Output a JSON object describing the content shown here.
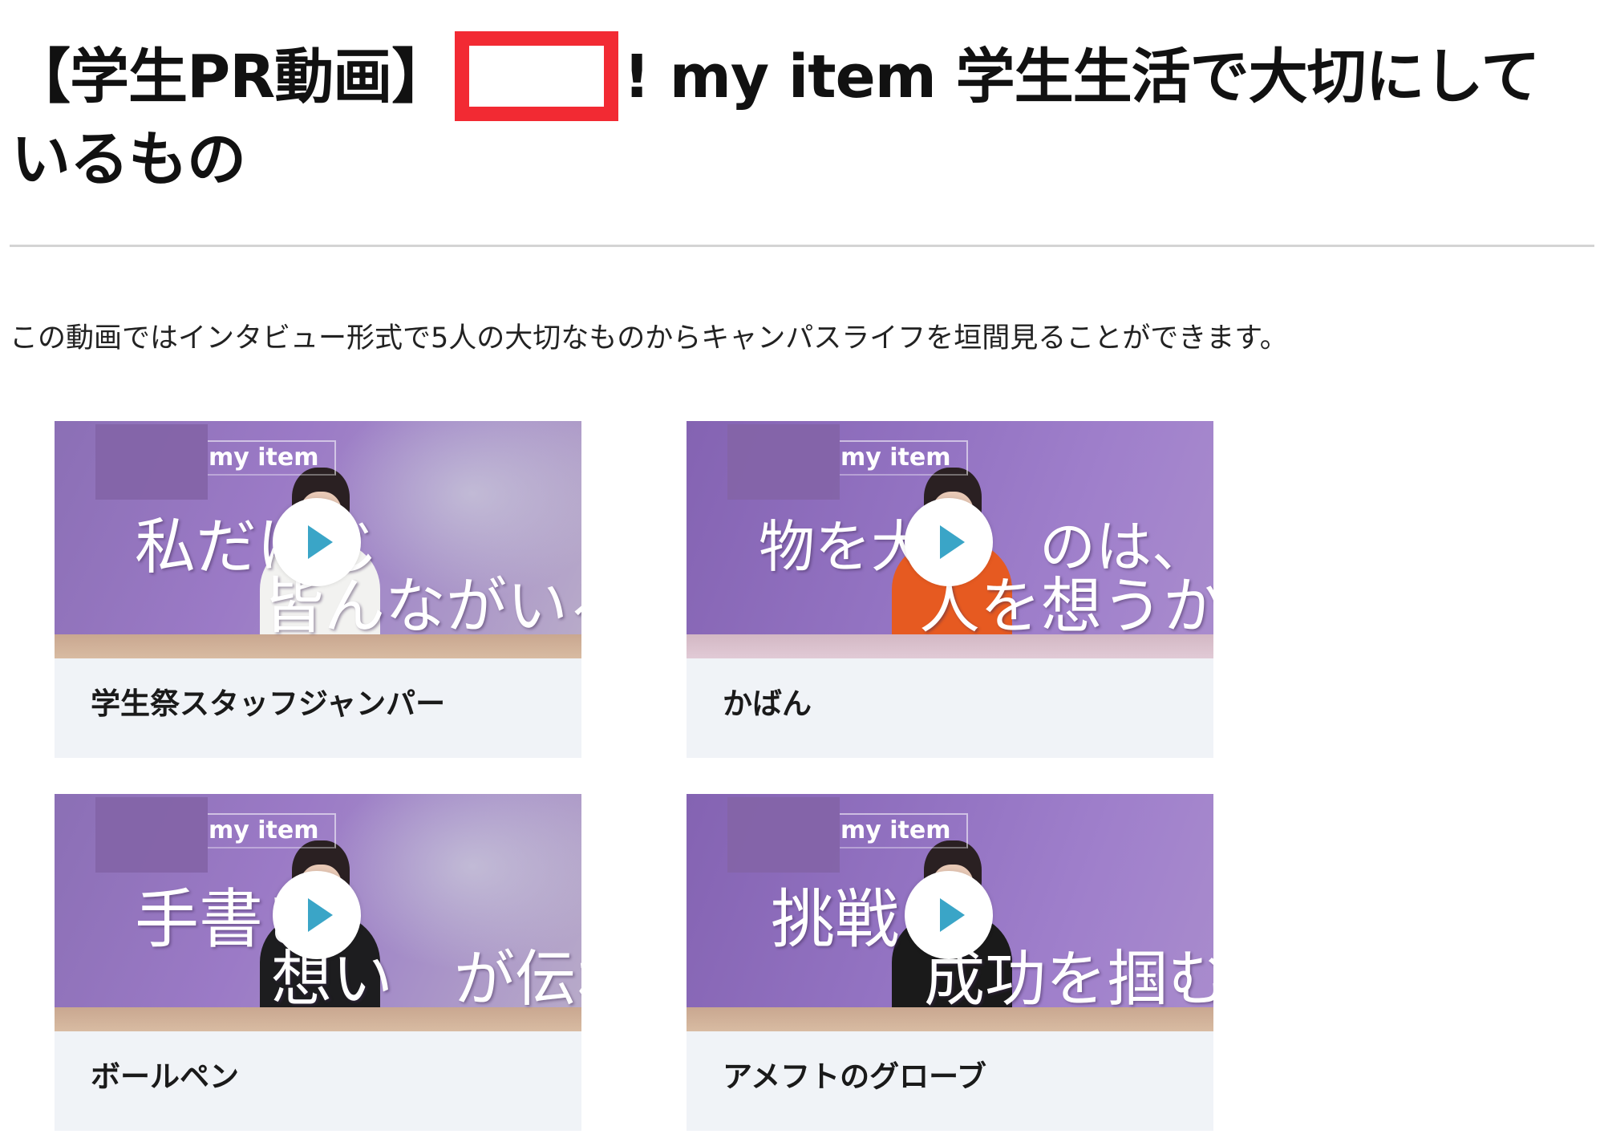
{
  "article": {
    "title_prefix": "【学生PR動画】",
    "title_suffix": "! my item 学生生活で大切にしているもの",
    "intro": "この動画ではインタビュー形式で5人の大切なものからキャンパスライフを垣間見ることができます。"
  },
  "videos": [
    {
      "tag": "my item",
      "line1": "私だけじ",
      "line2": "皆んながいる。",
      "caption": "学生祭スタッフジャンパー",
      "outfit_color": "#f2f2f0"
    },
    {
      "tag": "my item",
      "line1": "物を大切　のは、",
      "line2": "人を想うから。",
      "caption": "かばん",
      "outfit_color": "#e65a21"
    },
    {
      "tag": "my item",
      "line1": "手書き",
      "line2": "想い　が伝わる。",
      "caption": "ボールペン",
      "outfit_color": "#1d1d1f"
    },
    {
      "tag": "my item",
      "line1": "挑戦し",
      "line2": "成功を掴む。",
      "caption": "アメフトのグローブ",
      "outfit_color": "#1a1a1a"
    }
  ],
  "colors": {
    "redaction": "#f22a33",
    "play_arrow": "#3aa5c7",
    "card_background": "#f0f3f7"
  },
  "icons": {
    "play": "play-icon"
  }
}
